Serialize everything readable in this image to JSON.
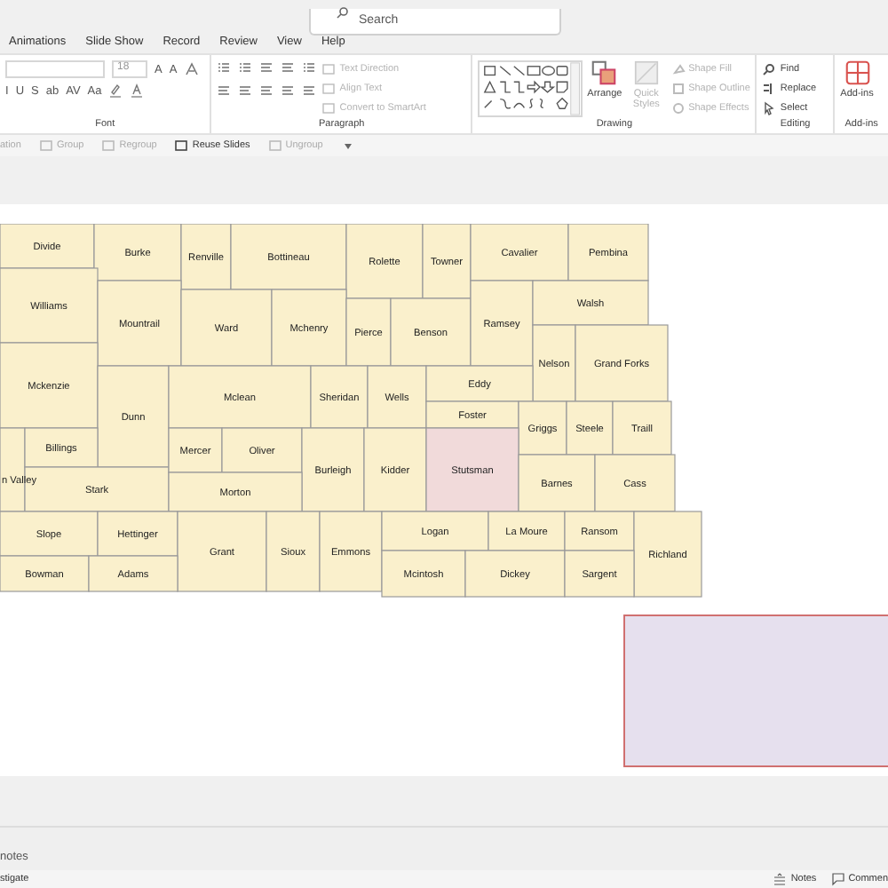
{
  "search": {
    "placeholder": "Search"
  },
  "tabs": [
    {
      "label": "Animations",
      "selected": false
    },
    {
      "label": "Slide Show",
      "selected": false
    },
    {
      "label": "Record",
      "selected": false
    },
    {
      "label": "Review",
      "selected": false
    },
    {
      "label": "View",
      "selected": false
    },
    {
      "label": "Help",
      "selected": false
    }
  ],
  "font_group": {
    "label": "Font",
    "size": "18",
    "row1_buttons": [
      "A",
      "A"
    ],
    "row2_buttons": [
      "I",
      "U",
      "S",
      "ab",
      "AV",
      "Aa"
    ]
  },
  "paragraph_group": {
    "label": "Paragraph",
    "commands": [
      {
        "label": "Text Direction",
        "disabled": true
      },
      {
        "label": "Align Text",
        "disabled": true
      },
      {
        "label": "Convert to SmartArt",
        "disabled": true
      }
    ]
  },
  "drawing_group": {
    "label": "Drawing",
    "arrange": "Arrange",
    "quick_styles": {
      "label": "Quick Styles",
      "disabled": true
    },
    "commands": [
      {
        "label": "Shape Fill",
        "disabled": true
      },
      {
        "label": "Shape Outline",
        "disabled": true
      },
      {
        "label": "Shape Effects",
        "disabled": true
      }
    ]
  },
  "editing_group": {
    "label": "Editing",
    "commands": [
      {
        "label": "Find"
      },
      {
        "label": "Replace"
      },
      {
        "label": "Select"
      }
    ]
  },
  "addins_group": {
    "label": "Add-ins",
    "button": "Add-ins"
  },
  "quick_toolbar": [
    {
      "label": "ation",
      "disabled": true
    },
    {
      "label": "Group",
      "disabled": true
    },
    {
      "label": "Regroup",
      "disabled": true
    },
    {
      "label": "Reuse Slides",
      "disabled": false
    },
    {
      "label": "Ungroup",
      "disabled": true
    }
  ],
  "map": {
    "counties": [
      {
        "name": "Divide",
        "selected": false
      },
      {
        "name": "Burke",
        "selected": false
      },
      {
        "name": "Renville",
        "selected": false
      },
      {
        "name": "Bottineau",
        "selected": false
      },
      {
        "name": "Rolette",
        "selected": false
      },
      {
        "name": "Towner",
        "selected": false
      },
      {
        "name": "Cavalier",
        "selected": false
      },
      {
        "name": "Pembina",
        "selected": false
      },
      {
        "name": "Williams",
        "selected": false
      },
      {
        "name": "Mountrail",
        "selected": false
      },
      {
        "name": "Ward",
        "selected": false
      },
      {
        "name": "Mchenry",
        "selected": false
      },
      {
        "name": "Pierce",
        "selected": false
      },
      {
        "name": "Benson",
        "selected": false
      },
      {
        "name": "Ramsey",
        "selected": false
      },
      {
        "name": "Walsh",
        "selected": false
      },
      {
        "name": "Nelson",
        "selected": false
      },
      {
        "name": "Grand Forks",
        "selected": false
      },
      {
        "name": "Mckenzie",
        "selected": false
      },
      {
        "name": "Dunn",
        "selected": false
      },
      {
        "name": "Mclean",
        "selected": false
      },
      {
        "name": "Sheridan",
        "selected": false
      },
      {
        "name": "Wells",
        "selected": false
      },
      {
        "name": "Eddy",
        "selected": false
      },
      {
        "name": "Foster",
        "selected": false
      },
      {
        "name": "Griggs",
        "selected": false
      },
      {
        "name": "Steele",
        "selected": false
      },
      {
        "name": "Traill",
        "selected": false
      },
      {
        "name": "n Valley",
        "selected": false
      },
      {
        "name": "Billings",
        "selected": false
      },
      {
        "name": "Stark",
        "selected": false
      },
      {
        "name": "Mercer",
        "selected": false
      },
      {
        "name": "Oliver",
        "selected": false
      },
      {
        "name": "Burleigh",
        "selected": false
      },
      {
        "name": "Kidder",
        "selected": false
      },
      {
        "name": "Stutsman",
        "selected": true
      },
      {
        "name": "Barnes",
        "selected": false
      },
      {
        "name": "Cass",
        "selected": false
      },
      {
        "name": "Morton",
        "selected": false
      },
      {
        "name": "Slope",
        "selected": false
      },
      {
        "name": "Hettinger",
        "selected": false
      },
      {
        "name": "Grant",
        "selected": false
      },
      {
        "name": "Sioux",
        "selected": false
      },
      {
        "name": "Emmons",
        "selected": false
      },
      {
        "name": "Logan",
        "selected": false
      },
      {
        "name": "La Moure",
        "selected": false
      },
      {
        "name": "Ransom",
        "selected": false
      },
      {
        "name": "Richland",
        "selected": false
      },
      {
        "name": "Bowman",
        "selected": false
      },
      {
        "name": "Adams",
        "selected": false
      },
      {
        "name": "Mcintosh",
        "selected": false
      },
      {
        "name": "Dickey",
        "selected": false
      },
      {
        "name": "Sargent",
        "selected": false
      }
    ]
  },
  "notes": {
    "placeholder": "notes"
  },
  "status_bar": {
    "left": "stigate",
    "notes": "Notes",
    "comments": "Commen"
  }
}
